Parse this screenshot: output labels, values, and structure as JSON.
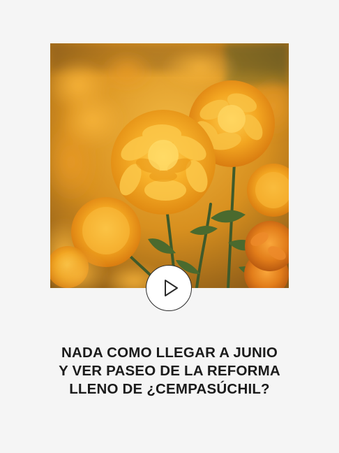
{
  "post": {
    "image_alt": "cempasúchil flowers",
    "play_icon": "play-icon",
    "caption_lines": [
      "NADA COMO LLEGAR A JUNIO",
      "Y VER PASEO DE LA REFORMA",
      "LLENO DE ¿CEMPASÚCHIL?"
    ]
  },
  "colors": {
    "background": "#f5f5f5",
    "text": "#1b1b1b",
    "flower_orange": "#f5a623",
    "leaf_green": "#3f5a2a"
  }
}
